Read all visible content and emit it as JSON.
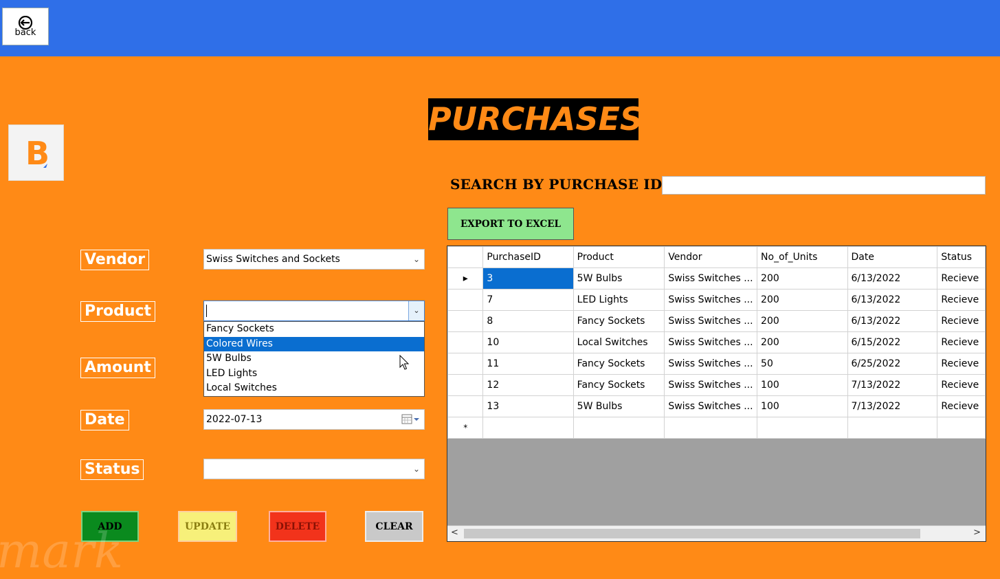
{
  "header": {
    "back_label": "back"
  },
  "logo_letter": "B",
  "page_title": "PURCHASES",
  "search": {
    "label": "SEARCH BY PURCHASE ID",
    "value": ""
  },
  "export_label": "EXPORT TO EXCEL",
  "form": {
    "vendor_label": "Vendor",
    "vendor_value": "Swiss Switches and Sockets",
    "product_label": "Product",
    "product_value": "",
    "amount_label": "Amount",
    "date_label": "Date",
    "date_value": "2022-07-13",
    "status_label": "Status",
    "status_value": ""
  },
  "product_options": [
    "Fancy Sockets",
    "Colored Wires",
    "5W Bulbs",
    "LED Lights",
    "Local Switches"
  ],
  "product_highlighted": "Colored Wires",
  "buttons": {
    "add": "ADD",
    "update": "UPDATE",
    "delete": "DELETE",
    "clear": "CLEAR"
  },
  "colors": {
    "background": "#ff8a16",
    "header": "#2f6fe8",
    "add": "#0a8a1e",
    "update": "#f7f07a",
    "delete": "#f2331b",
    "clear": "#c9c9c9",
    "export": "#8ee68e"
  },
  "grid": {
    "columns": [
      "PurchaseID",
      "Product",
      "Vendor",
      "No_of_Units",
      "Date",
      "Status"
    ],
    "rows": [
      [
        "3",
        "5W Bulbs",
        "Swiss Switches ...",
        "200",
        "6/13/2022",
        "Recieve"
      ],
      [
        "7",
        "LED Lights",
        "Swiss Switches ...",
        "200",
        "6/13/2022",
        "Recieve"
      ],
      [
        "8",
        "Fancy Sockets",
        "Swiss Switches ...",
        "200",
        "6/13/2022",
        "Recieve"
      ],
      [
        "10",
        "Local Switches",
        "Swiss Switches ...",
        "200",
        "6/15/2022",
        "Recieve"
      ],
      [
        "11",
        "Fancy Sockets",
        "Swiss Switches ...",
        "50",
        "6/25/2022",
        "Recieve"
      ],
      [
        "12",
        "Fancy Sockets",
        "Swiss Switches ...",
        "100",
        "7/13/2022",
        "Recieve"
      ],
      [
        "13",
        "5W Bulbs",
        "Swiss Switches ...",
        "100",
        "7/13/2022",
        "Recieve"
      ]
    ],
    "current_row_marker": "▸",
    "new_row_marker": "*"
  },
  "watermark": "mark"
}
